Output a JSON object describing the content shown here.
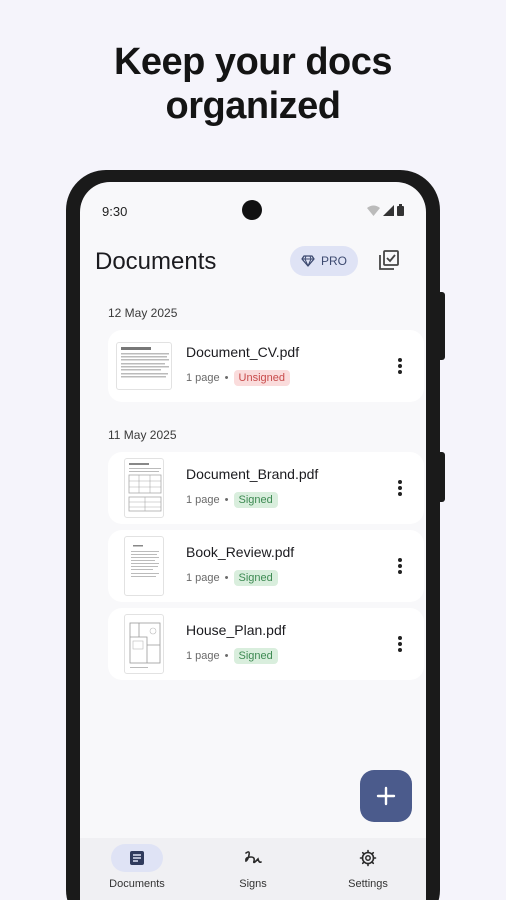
{
  "headline": {
    "line1": "Keep your docs",
    "line2": "organized"
  },
  "status_bar": {
    "time": "9:30"
  },
  "app_bar": {
    "title": "Documents",
    "pro_label": "PRO"
  },
  "groups": [
    {
      "date": "12 May 2025",
      "documents": [
        {
          "name": "Document_CV.pdf",
          "pages": "1 page",
          "separator": "•",
          "status": "Unsigned"
        }
      ]
    },
    {
      "date": "11 May 2025",
      "documents": [
        {
          "name": "Document_Brand.pdf",
          "pages": "1 page",
          "separator": "•",
          "status": "Signed"
        },
        {
          "name": "Book_Review.pdf",
          "pages": "1 page",
          "separator": "•",
          "status": "Signed"
        },
        {
          "name": "House_Plan.pdf",
          "pages": "1 page",
          "separator": "•",
          "status": "Signed"
        }
      ]
    }
  ],
  "fab": {
    "icon": "plus-icon"
  },
  "bottom_nav": {
    "items": [
      {
        "label": "Documents",
        "icon": "document-icon",
        "active": true
      },
      {
        "label": "Signs",
        "icon": "signature-icon",
        "active": false
      },
      {
        "label": "Settings",
        "icon": "gear-icon",
        "active": false
      }
    ]
  },
  "colors": {
    "background": "#f5f4fb",
    "accent": "#4b5b8c",
    "pro_bg": "#dfe3f5",
    "unsigned_bg": "#fadcdc",
    "unsigned_text": "#c84b4b",
    "signed_bg": "#d9eedd",
    "signed_text": "#3d8a52"
  }
}
